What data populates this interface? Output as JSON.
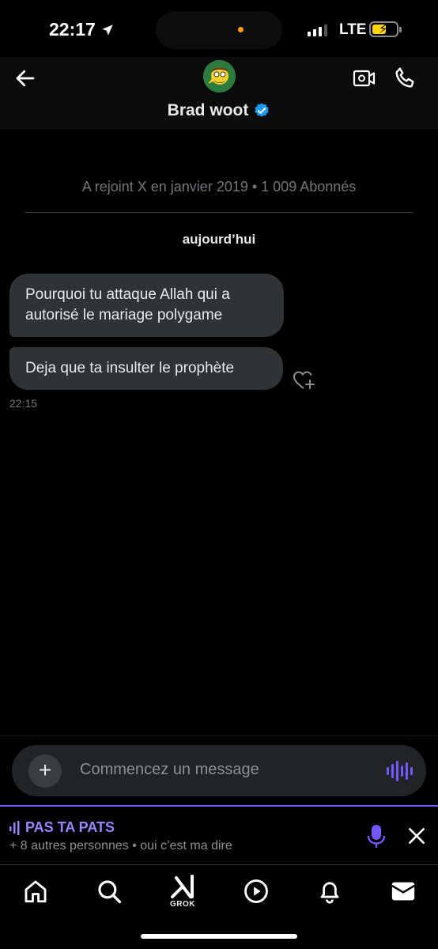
{
  "status_bar": {
    "time": "22:17",
    "network": "LTE",
    "battery_color": "#ffd60a"
  },
  "header": {
    "name": "Brad woot",
    "verified": true
  },
  "conversation": {
    "joined_text": "A rejoint X en janvier 2019 • 1 009 Abonnés",
    "day_label": "aujourd’hui",
    "messages": [
      {
        "text": "Pourquoi tu attaque Allah qui a autorisé le mariage polygame"
      },
      {
        "text": "Deja que ta insulter le prophète"
      }
    ],
    "last_time": "22:15"
  },
  "composer": {
    "placeholder": "Commencez un message",
    "icon": "plus-icon"
  },
  "space": {
    "title": "PAS TA PATS",
    "subtitle": "+ 8 autres personnes • oui c’est ma dire",
    "accent": "#7856ff"
  },
  "nav": {
    "grok_label": "GROK",
    "items": [
      "home-icon",
      "search-icon",
      "grok-icon",
      "play-icon",
      "bell-icon",
      "mail-icon"
    ]
  }
}
